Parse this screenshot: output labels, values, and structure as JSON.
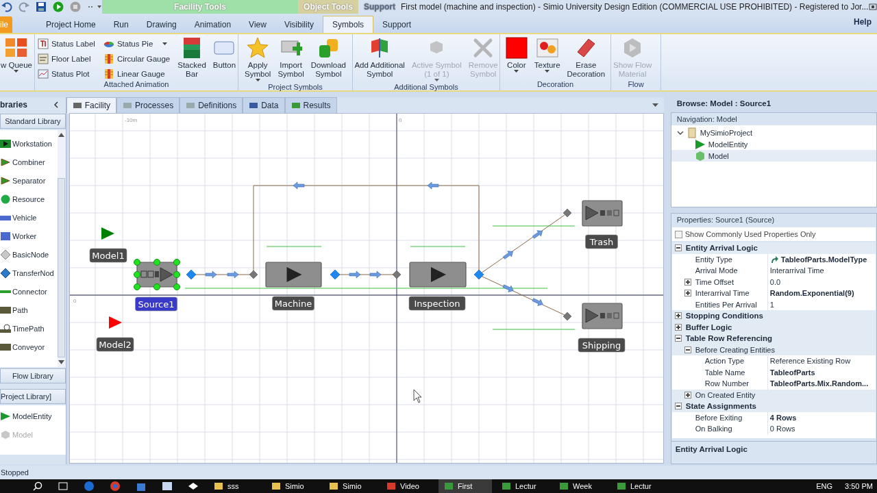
{
  "title_bar": {
    "context_tabs": [
      {
        "label": "Facility Tools",
        "kind": "facility"
      },
      {
        "label": "Object Tools",
        "kind": "object"
      },
      {
        "label": "Support",
        "kind": "support"
      }
    ],
    "title": "First model (machine and inspection) - Simio University Design Edition (COMMERCIAL USE PROHIBITED) - Registered to Jor..."
  },
  "ribbon_tabs": [
    {
      "label": "ile",
      "kind": "file",
      "selected": false
    },
    {
      "label": "Project Home",
      "kind": "tab",
      "selected": false
    },
    {
      "label": "Run",
      "kind": "tab",
      "selected": false
    },
    {
      "label": "Drawing",
      "kind": "tab",
      "selected": false
    },
    {
      "label": "Animation",
      "kind": "tab",
      "selected": false
    },
    {
      "label": "View",
      "kind": "tab",
      "selected": false
    },
    {
      "label": "Visibility",
      "kind": "tab",
      "selected": false
    },
    {
      "label": "Symbols",
      "kind": "tab",
      "selected": true
    },
    {
      "label": "Support",
      "kind": "tab",
      "selected": false
    }
  ],
  "help": "Help",
  "ribbon_groups": [
    {
      "items": [
        {
          "kind": "large",
          "lines": [
            "w Queue"
          ],
          "disabled": false,
          "dropdown": true
        }
      ]
    },
    {
      "label": "Attached Animation",
      "items": [
        {
          "kind": "small",
          "label": "Status Label",
          "disabled": false,
          "dropdown": false
        },
        {
          "kind": "small",
          "label": "Floor Label",
          "disabled": false,
          "dropdown": false
        },
        {
          "kind": "small",
          "label": "Status Plot",
          "disabled": false,
          "dropdown": false
        },
        {
          "kind": "small",
          "label": "Status Pie",
          "disabled": false,
          "dropdown": true
        },
        {
          "kind": "small",
          "label": "Circular Gauge",
          "disabled": false,
          "dropdown": false
        },
        {
          "kind": "small",
          "label": "Linear Gauge",
          "disabled": false,
          "dropdown": false
        },
        {
          "kind": "large",
          "lines": [
            "Stacked",
            "Bar"
          ],
          "disabled": false,
          "dropdown": false
        },
        {
          "kind": "large",
          "lines": [
            "Button"
          ],
          "disabled": false,
          "dropdown": false
        }
      ]
    },
    {
      "label": "Project Symbols",
      "items": [
        {
          "kind": "large",
          "lines": [
            "Apply",
            "Symbol"
          ],
          "disabled": false,
          "dropdown": true
        },
        {
          "kind": "large",
          "lines": [
            "Import",
            "Symbol"
          ],
          "disabled": false,
          "dropdown": false
        },
        {
          "kind": "large",
          "lines": [
            "Download",
            "Symbol"
          ],
          "disabled": false,
          "dropdown": false
        }
      ]
    },
    {
      "label": "Additional Symbols",
      "items": [
        {
          "kind": "large",
          "lines": [
            "Add Additional",
            "Symbol"
          ],
          "disabled": false,
          "dropdown": false
        },
        {
          "kind": "large",
          "lines": [
            "Active Symbol",
            "(1 of 1)"
          ],
          "disabled": true,
          "dropdown": true
        },
        {
          "kind": "large",
          "lines": [
            "Remove",
            "Symbol"
          ],
          "disabled": true,
          "dropdown": false
        }
      ]
    },
    {
      "label": "Decoration",
      "items": [
        {
          "kind": "large",
          "lines": [
            "Color"
          ],
          "disabled": false,
          "dropdown": true
        },
        {
          "kind": "large",
          "lines": [
            "Texture"
          ],
          "disabled": false,
          "dropdown": true
        },
        {
          "kind": "large",
          "lines": [
            "Erase",
            "Decoration"
          ],
          "disabled": false,
          "dropdown": false
        }
      ]
    },
    {
      "label": "Flow",
      "items": [
        {
          "kind": "large",
          "lines": [
            "Show Flow",
            "Material"
          ],
          "disabled": true,
          "dropdown": false
        }
      ]
    }
  ],
  "doc_tabs": [
    {
      "label": "Facility",
      "selected": true
    },
    {
      "label": "Processes",
      "selected": false
    },
    {
      "label": "Definitions",
      "selected": false
    },
    {
      "label": "Data",
      "selected": false
    },
    {
      "label": "Results",
      "selected": false
    }
  ],
  "libraries": {
    "title": "braries",
    "standard": "Standard Library",
    "items": [
      {
        "label": "Workstation",
        "disabled": false
      },
      {
        "label": "Combiner",
        "disabled": false
      },
      {
        "label": "Separator",
        "disabled": false
      },
      {
        "label": "Resource",
        "disabled": false
      },
      {
        "label": "Vehicle",
        "disabled": false
      },
      {
        "label": "Worker",
        "disabled": false
      },
      {
        "label": "BasicNode",
        "disabled": false
      },
      {
        "label": "TransferNod",
        "disabled": false
      },
      {
        "label": "Connector",
        "disabled": false
      },
      {
        "label": "Path",
        "disabled": false
      },
      {
        "label": "TimePath",
        "disabled": false
      },
      {
        "label": "Conveyor",
        "disabled": false
      }
    ],
    "flow": "Flow Library",
    "project": "Project Library]",
    "project_items": [
      {
        "label": "ModelEntity",
        "disabled": false
      },
      {
        "label": "Model",
        "disabled": true
      }
    ]
  },
  "canvas": {
    "axis_labels": [
      "-10m",
      "0",
      "0"
    ],
    "objects": [
      {
        "label": "Model1",
        "kind": "entity",
        "color": "#008000",
        "selected": false
      },
      {
        "label": "Model2",
        "kind": "entity",
        "color": "#ff0000",
        "selected": false
      },
      {
        "label": "Source1",
        "kind": "source",
        "selected": true
      },
      {
        "label": "Machine",
        "kind": "server",
        "selected": false
      },
      {
        "label": "Inspection",
        "kind": "server",
        "selected": false
      },
      {
        "label": "Trash",
        "kind": "sink",
        "selected": false
      },
      {
        "label": "Shipping",
        "kind": "sink",
        "selected": false
      }
    ]
  },
  "browse": {
    "title": "Browse: Model : Source1",
    "navigation": "Navigation: Model",
    "tree": [
      {
        "label": "MySimioProject",
        "expanded": true,
        "selected": false,
        "children": [
          {
            "label": "ModelEntity",
            "selected": false
          },
          {
            "label": "Model",
            "selected": true
          }
        ]
      }
    ]
  },
  "properties": {
    "title": "Properties: Source1 (Source)",
    "common_only": {
      "label": "Show Commonly Used Properties Only",
      "checked": false
    },
    "rows": [
      {
        "kind": "category",
        "label": "Entity Arrival Logic",
        "expanded": true,
        "children": [
          {
            "kind": "reference",
            "label": "Entity Type",
            "value": "TableofParts.ModelType",
            "bold": true
          },
          {
            "kind": "property",
            "label": "Arrival Mode",
            "value": "Interarrival Time",
            "bold": false
          },
          {
            "kind": "property",
            "label": "Time Offset",
            "value": "0.0",
            "bold": false,
            "expanded": false
          },
          {
            "kind": "property",
            "label": "Interarrival Time",
            "value": "Random.Exponential(9)",
            "bold": true,
            "expanded": false
          },
          {
            "kind": "property",
            "label": "Entities Per Arrival",
            "value": "1",
            "bold": false
          }
        ]
      },
      {
        "kind": "category",
        "label": "Stopping Conditions",
        "expanded": false
      },
      {
        "kind": "category",
        "label": "Buffer Logic",
        "expanded": false
      },
      {
        "kind": "category",
        "label": "Table Row Referencing",
        "expanded": true,
        "children": [
          {
            "kind": "group",
            "label": "Before Creating Entities",
            "expanded": true,
            "children": [
              {
                "kind": "property",
                "label": "Action Type",
                "value": "Reference Existing Row",
                "bold": false
              },
              {
                "kind": "property",
                "label": "Table Name",
                "value": "TableofParts",
                "bold": true
              },
              {
                "kind": "property",
                "label": "Row Number",
                "value": "TableofParts.Mix.Random...",
                "bold": true
              }
            ]
          },
          {
            "kind": "group",
            "label": "On Created Entity",
            "expanded": false
          }
        ]
      },
      {
        "kind": "category",
        "label": "State Assignments",
        "expanded": true,
        "children": [
          {
            "kind": "property",
            "label": "Before Exiting",
            "value": "4 Rows",
            "bold": true
          },
          {
            "kind": "property",
            "label": "On Balking",
            "value": "0 Rows",
            "bold": false
          }
        ]
      }
    ],
    "description": "Entity Arrival Logic"
  },
  "status_bar": "Stopped",
  "taskbar": {
    "items": [
      {
        "label": "sss",
        "selected": false
      },
      {
        "label": "Simio",
        "selected": false
      },
      {
        "label": "Simio",
        "selected": false
      },
      {
        "label": "Video",
        "selected": false
      },
      {
        "label": "First",
        "selected": true
      },
      {
        "label": "Lectur",
        "selected": false
      },
      {
        "label": "Week",
        "selected": false
      },
      {
        "label": "Lectur",
        "selected": false
      }
    ],
    "language": "ENG",
    "time": "3:50 PM"
  }
}
